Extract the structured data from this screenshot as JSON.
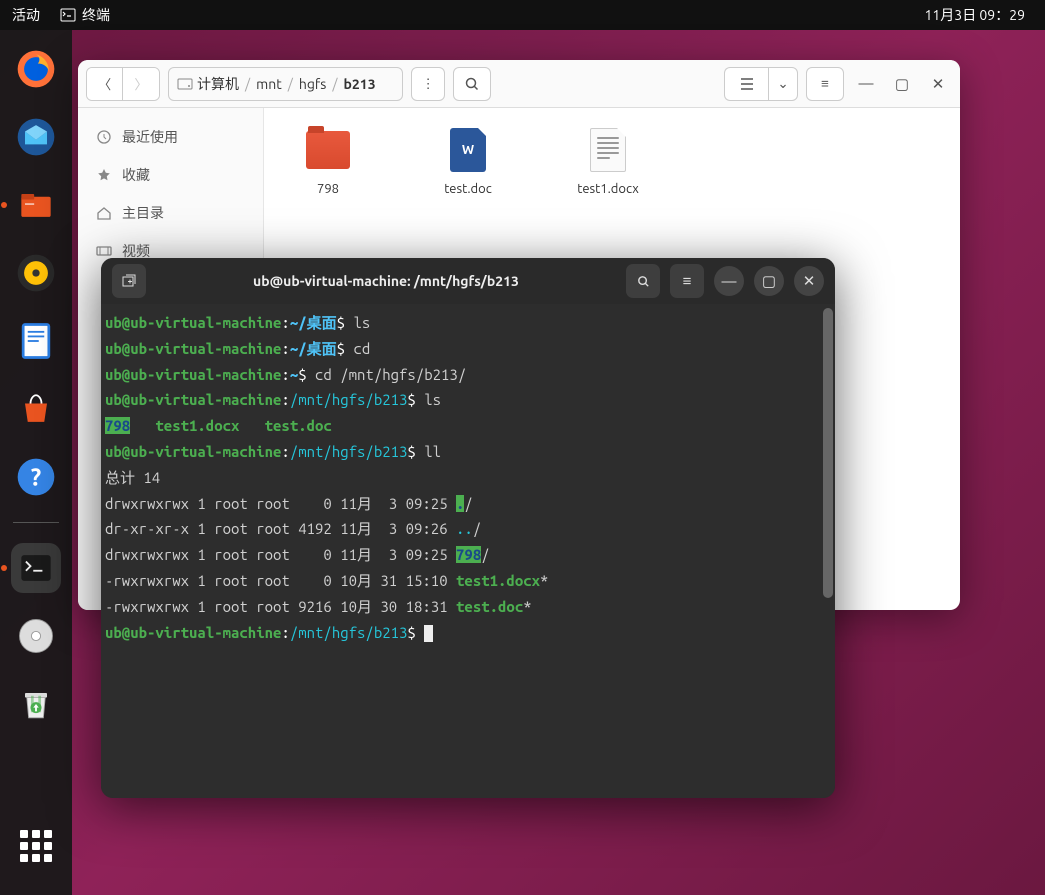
{
  "topbar": {
    "activities": "活动",
    "app": "终端",
    "datetime": "11月3日 09：29"
  },
  "dock": {
    "items": [
      "firefox",
      "thunderbird",
      "files",
      "rhythmbox",
      "writer",
      "software",
      "help",
      "terminal",
      "disk",
      "trash",
      "apps"
    ]
  },
  "filewin": {
    "breadcrumb": {
      "root": "计算机",
      "p1": "mnt",
      "p2": "hgfs",
      "p3": "b213"
    },
    "sidebar": [
      {
        "icon": "clock",
        "label": "最近使用"
      },
      {
        "icon": "star",
        "label": "收藏"
      },
      {
        "icon": "home",
        "label": "主目录"
      },
      {
        "icon": "video",
        "label": "视频"
      }
    ],
    "files": [
      {
        "type": "folder",
        "name": "798"
      },
      {
        "type": "doc",
        "name": "test.doc"
      },
      {
        "type": "txt",
        "name": "test1.docx"
      }
    ]
  },
  "terminal": {
    "title": "ub@ub-virtual-machine: /mnt/hgfs/b213",
    "lines": [
      {
        "user": "ub@ub-virtual-machine",
        "sep": ":",
        "path": "~/桌面",
        "prompt": "$ ",
        "cmd": "ls",
        "pathcolor": "b"
      },
      {
        "user": "ub@ub-virtual-machine",
        "sep": ":",
        "path": "~/桌面",
        "prompt": "$ ",
        "cmd": "cd",
        "pathcolor": "b"
      },
      {
        "user": "ub@ub-virtual-machine",
        "sep": ":",
        "path": "~",
        "prompt": "$ ",
        "cmd": "cd /mnt/hgfs/b213/",
        "pathcolor": "b"
      },
      {
        "user": "ub@ub-virtual-machine",
        "sep": ":",
        "path": "/mnt/hgfs/b213",
        "prompt": "$ ",
        "cmd": "ls",
        "pathcolor": "c"
      },
      {
        "raw": true,
        "segments": [
          {
            "text": "798",
            "cls": "bg-g"
          },
          {
            "text": "   "
          },
          {
            "text": "test1.docx",
            "cls": "g"
          },
          {
            "text": "   "
          },
          {
            "text": "test.doc",
            "cls": "g"
          }
        ]
      },
      {
        "user": "ub@ub-virtual-machine",
        "sep": ":",
        "path": "/mnt/hgfs/b213",
        "prompt": "$ ",
        "cmd": "ll",
        "pathcolor": "c"
      },
      {
        "plain": "总计 14"
      },
      {
        "raw": true,
        "segments": [
          {
            "text": "drwxrwxrwx 1 root root    0 11月  3 09:25 "
          },
          {
            "text": ".",
            "cls": "bg-g"
          },
          {
            "text": "/"
          }
        ]
      },
      {
        "raw": true,
        "segments": [
          {
            "text": "dr-xr-xr-x 1 root root 4192 11月  3 09:26 "
          },
          {
            "text": "..",
            "cls": "c"
          },
          {
            "text": "/"
          }
        ]
      },
      {
        "raw": true,
        "segments": [
          {
            "text": "drwxrwxrwx 1 root root    0 11月  3 09:25 "
          },
          {
            "text": "798",
            "cls": "bg-g"
          },
          {
            "text": "/"
          }
        ]
      },
      {
        "raw": true,
        "segments": [
          {
            "text": "-rwxrwxrwx 1 root root    0 10月 31 15:10 "
          },
          {
            "text": "test1.docx",
            "cls": "g"
          },
          {
            "text": "*"
          }
        ]
      },
      {
        "raw": true,
        "segments": [
          {
            "text": "-rwxrwxrwx 1 root root 9216 10月 30 18:31 "
          },
          {
            "text": "test.doc",
            "cls": "g"
          },
          {
            "text": "*"
          }
        ]
      },
      {
        "user": "ub@ub-virtual-machine",
        "sep": ":",
        "path": "/mnt/hgfs/b213",
        "prompt": "$ ",
        "cmd": "",
        "pathcolor": "c",
        "cursor": true
      }
    ]
  }
}
